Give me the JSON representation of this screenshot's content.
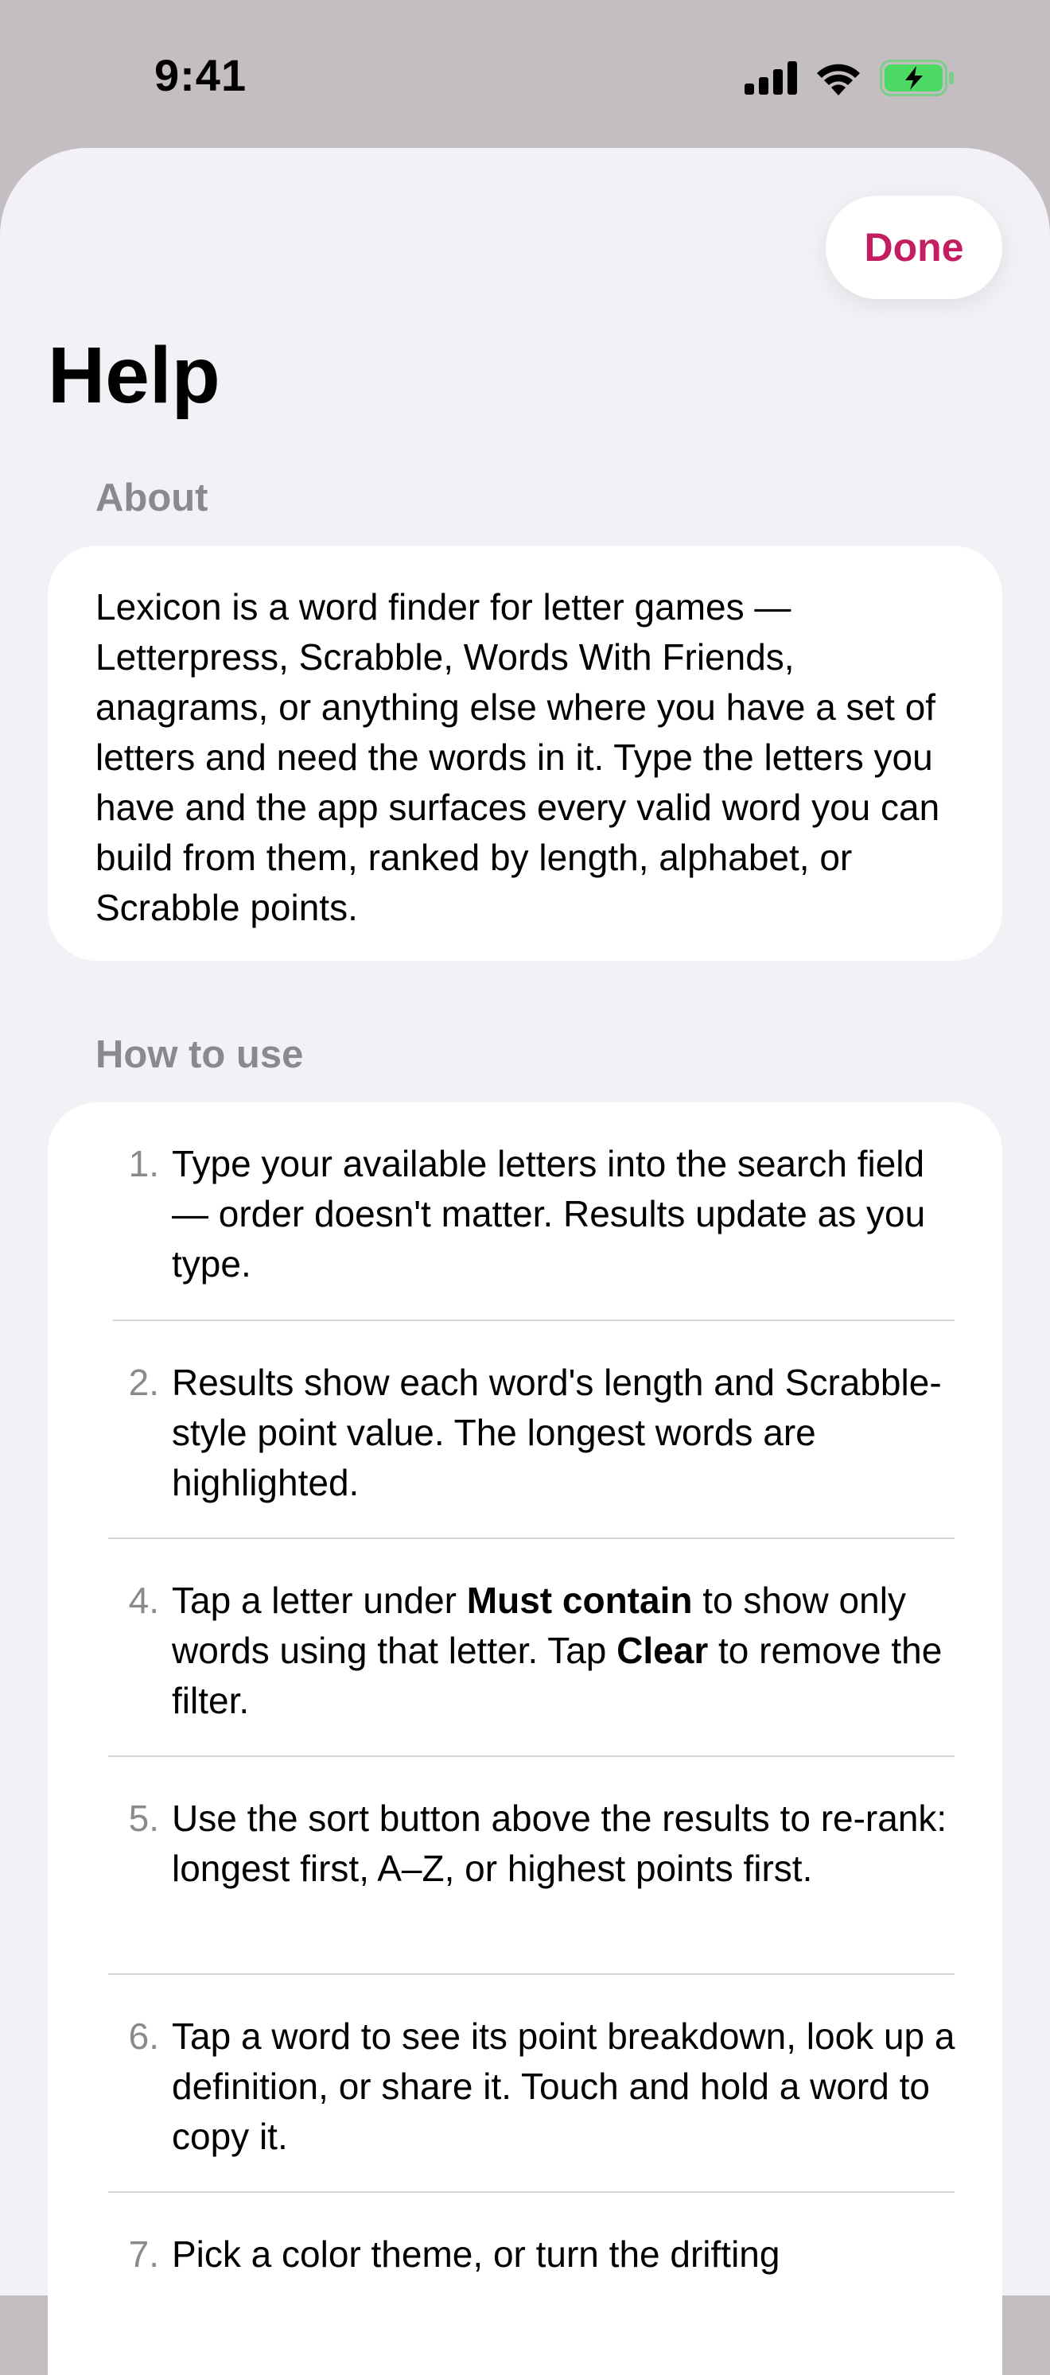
{
  "status_bar": {
    "time": "9:41"
  },
  "header": {
    "done_label": "Done",
    "title": "Help"
  },
  "about": {
    "header": "About",
    "text": "Lexicon is a word finder for letter games — Letterpress, Scrabble, Words With Friends, anagrams, or anything else where you have a set of letters and need the words in it. Type the letters you have and the app surfaces every valid word you can build from them, ranked by length, alphabet, or Scrabble points."
  },
  "how_to_use": {
    "header": "How to use",
    "steps": [
      {
        "num": "1.",
        "text": "Type your available letters into the search field — order doesn't matter. Results update as you type."
      },
      {
        "num": "2.",
        "text": "Results show each word's length and Scrabble-style point value. The longest words are highlighted."
      },
      {
        "num": "4.",
        "pre": "Tap a letter under ",
        "bold1": "Must contain",
        "mid": " to show only words using that letter. Tap ",
        "bold2": "Clear",
        "post": " to remove the filter."
      },
      {
        "num": "5.",
        "text": "Use the sort button above the results to re-rank: longest first, A–Z, or highest points first."
      },
      {
        "num": "6.",
        "text": "Tap a word to see its point breakdown, look up a definition, or share it. Touch and hold a word to copy it."
      },
      {
        "num": "7.",
        "text": "Pick a color theme, or turn the drifting"
      }
    ]
  },
  "colors": {
    "accent": "#c41e63",
    "battery": "#4cd964",
    "secondary_text": "#8a8a8e"
  }
}
